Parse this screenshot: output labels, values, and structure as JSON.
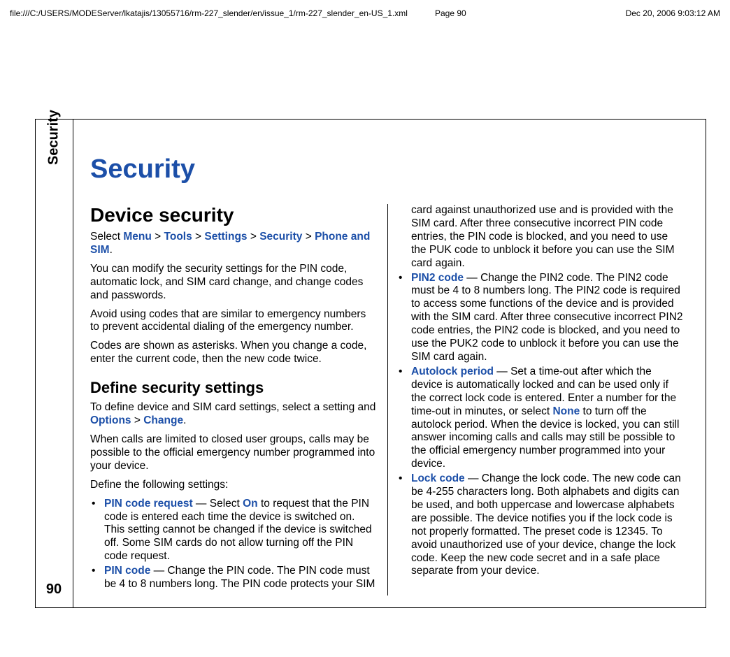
{
  "header": {
    "path": "file:///C:/USERS/MODEServer/lkatajis/13055716/rm-227_slender/en/issue_1/rm-227_slender_en-US_1.xml",
    "page_label": "Page 90",
    "datetime": "Dec 20, 2006 9:03:12 AM"
  },
  "sidebar": {
    "section": "Security",
    "page_number": "90"
  },
  "doc": {
    "h1": "Security",
    "h2_1": "Device security",
    "nav_prefix": "Select ",
    "nav": {
      "menu": "Menu",
      "tools": "Tools",
      "settings": "Settings",
      "security": "Security",
      "phone_sim": "Phone and SIM"
    },
    "nav_suffix": ".",
    "sep": " > ",
    "p1": "You can modify the security settings for the PIN code, automatic lock, and SIM card change, and change codes and passwords.",
    "p2": "Avoid using codes that are similar to emergency numbers to prevent accidental dialing of the emergency number.",
    "p3": "Codes are shown as asterisks. When you change a code, enter the current code, then the new code twice.",
    "h3_1": "Define security settings",
    "p4_prefix": "To define device and SIM card settings, select a setting and ",
    "p4_opt": "Options",
    "p4_change": "Change",
    "p4_suffix": ".",
    "p5": "When calls are limited to closed user groups, calls may be possible to the official emergency number programmed into your device.",
    "p6": "Define the following settings:",
    "items": {
      "bullet": "•",
      "pin_req_label": "PIN code request",
      "pin_req_pre": " — Select ",
      "pin_req_on": "On",
      "pin_req_post": " to request that the PIN code is entered each time the device is switched on. This setting cannot be changed if the device is switched off. Some SIM cards do not allow turning off the PIN code request.",
      "pin_code_label": "PIN code",
      "pin_code_text": " — Change the PIN code. The PIN code must be 4 to 8 numbers long. The PIN code protects your SIM card against unauthorized use and is provided with the SIM card. After three consecutive incorrect PIN code entries, the PIN code is blocked, and you need to use the PUK code to unblock it before you can use the SIM card again.",
      "pin2_label": "PIN2 code",
      "pin2_text": " — Change the PIN2 code. The PIN2 code must be 4 to 8 numbers long. The PIN2 code is required to access some functions of the device and is provided with the SIM card. After three consecutive incorrect PIN2 code entries, the PIN2 code is blocked, and you need to use the PUK2 code to unblock it before you can use the SIM card again.",
      "autolock_label": "Autolock period",
      "autolock_pre": "  — Set a time-out after which the device is automatically locked and can be used only if the correct lock code is entered. Enter a number for the time-out in minutes, or select ",
      "autolock_none": "None",
      "autolock_post": " to turn off the autolock period. When the device is locked, you can still answer incoming calls and calls may still be possible to the official emergency number programmed into your device.",
      "lock_label": "Lock code",
      "lock_text": " — Change the lock code. The new code can be 4-255 characters long. Both alphabets and digits can be used, and both uppercase and lowercase alphabets are possible. The device notifies you if the lock code is not properly formatted. The preset code is 12345. To avoid unauthorized use of your device, change the lock code. Keep the new code secret and in a safe place separate from your device."
    }
  }
}
